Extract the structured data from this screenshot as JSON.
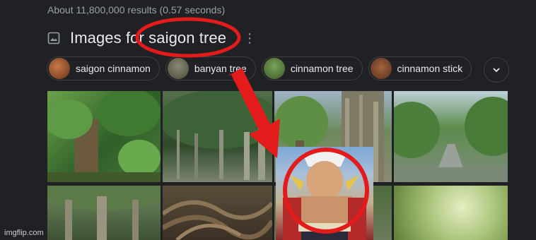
{
  "results_stats": "About 11,800,000 results (0.57 seconds)",
  "header": {
    "title": "Images for saigon tree",
    "more_label": "⋮"
  },
  "chips": [
    {
      "label": "saigon cinnamon",
      "thumb": "#8a4a2a"
    },
    {
      "label": "banyan tree",
      "thumb": "#6b6a55"
    },
    {
      "label": "cinnamon tree",
      "thumb": "#4f6f3a"
    },
    {
      "label": "cinnamon stick",
      "thumb": "#7a4a30"
    }
  ],
  "expand_icon": "chevron-down-icon",
  "images": [
    {
      "name": "image-leafy-tree",
      "colors": [
        "#4f8a3c",
        "#2c5a22"
      ]
    },
    {
      "name": "image-banyan-canopy",
      "colors": [
        "#3f5e3a",
        "#6f7a64"
      ]
    },
    {
      "name": "image-roadside-tree",
      "colors": [
        "#6a8a5a",
        "#8c8f7a"
      ]
    },
    {
      "name": "image-boulevard",
      "colors": [
        "#5a8a4a",
        "#a4b4a0"
      ]
    },
    {
      "name": "image-tree-trunks",
      "colors": [
        "#5a6a4a",
        "#3e4a30"
      ]
    },
    {
      "name": "image-twisted-roots",
      "colors": [
        "#4b3f2f",
        "#6c5a44"
      ]
    },
    {
      "name": "image-character-meme",
      "colors": [
        "#d9c7a0",
        "#8b2a2a"
      ]
    },
    {
      "name": "image-sunlit-leaves",
      "colors": [
        "#c2d79a",
        "#6a8a3a"
      ]
    }
  ],
  "annotation_colors": {
    "circle": "#e31b1b",
    "arrow": "#e31b1b"
  },
  "watermark": "imgflip.com"
}
